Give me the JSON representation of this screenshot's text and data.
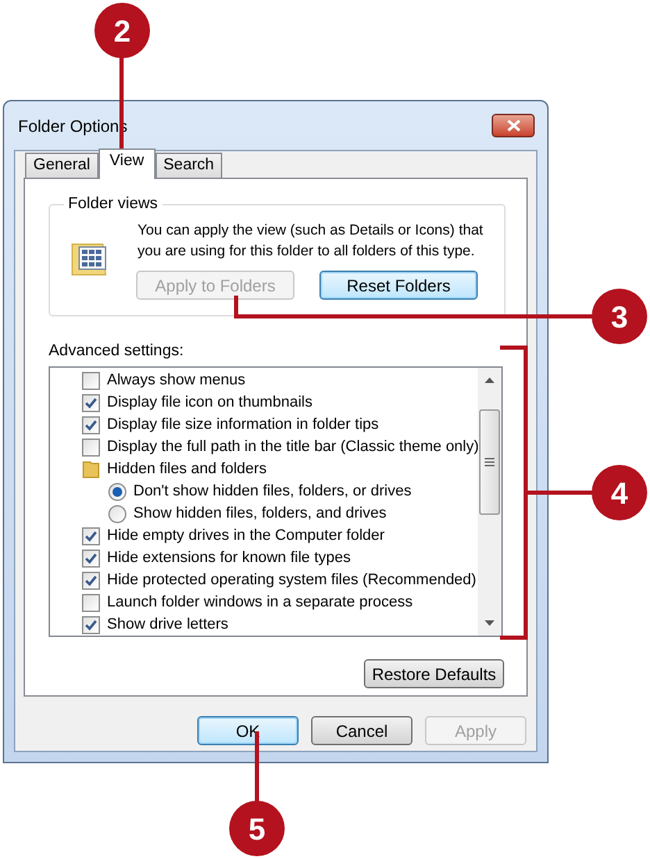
{
  "window": {
    "title": "Folder Options"
  },
  "tabs": [
    {
      "label": "General",
      "selected": false
    },
    {
      "label": "View",
      "selected": true
    },
    {
      "label": "Search",
      "selected": false
    }
  ],
  "folder_views": {
    "title": "Folder views",
    "description": "You can apply the view (such as Details or Icons) that you are using for this folder to all folders of this type.",
    "buttons": [
      {
        "label": "Apply to Folders",
        "disabled": true,
        "highlighted": false
      },
      {
        "label": "Reset Folders",
        "disabled": false,
        "highlighted": true
      }
    ]
  },
  "advanced_settings": {
    "label": "Advanced settings:",
    "items": [
      {
        "kind": "checkbox",
        "label": "Always show menus",
        "checked": false
      },
      {
        "kind": "checkbox",
        "label": "Display file icon on thumbnails",
        "checked": true
      },
      {
        "kind": "checkbox",
        "label": "Display file size information in folder tips",
        "checked": true
      },
      {
        "kind": "checkbox",
        "label": "Display the full path in the title bar (Classic theme only)",
        "checked": false
      },
      {
        "kind": "folder",
        "label": "Hidden files and folders",
        "children": [
          {
            "kind": "radio",
            "label": "Don't show hidden files, folders, or drives",
            "selected": true
          },
          {
            "kind": "radio",
            "label": "Show hidden files, folders, and drives",
            "selected": false
          }
        ]
      },
      {
        "kind": "checkbox",
        "label": "Hide empty drives in the Computer folder",
        "checked": true
      },
      {
        "kind": "checkbox",
        "label": "Hide extensions for known file types",
        "checked": true
      },
      {
        "kind": "checkbox",
        "label": "Hide protected operating system files (Recommended)",
        "checked": true
      },
      {
        "kind": "checkbox",
        "label": "Launch folder windows in a separate process",
        "checked": false
      },
      {
        "kind": "checkbox",
        "label": "Show drive letters",
        "checked": true
      }
    ],
    "restore_button": "Restore Defaults"
  },
  "dialog_buttons": [
    {
      "label": "OK",
      "disabled": false,
      "highlighted": true
    },
    {
      "label": "Cancel",
      "disabled": false,
      "highlighted": false
    },
    {
      "label": "Apply",
      "disabled": true,
      "highlighted": false
    }
  ],
  "callouts": [
    {
      "number": "2"
    },
    {
      "number": "3"
    },
    {
      "number": "4"
    },
    {
      "number": "5"
    }
  ]
}
